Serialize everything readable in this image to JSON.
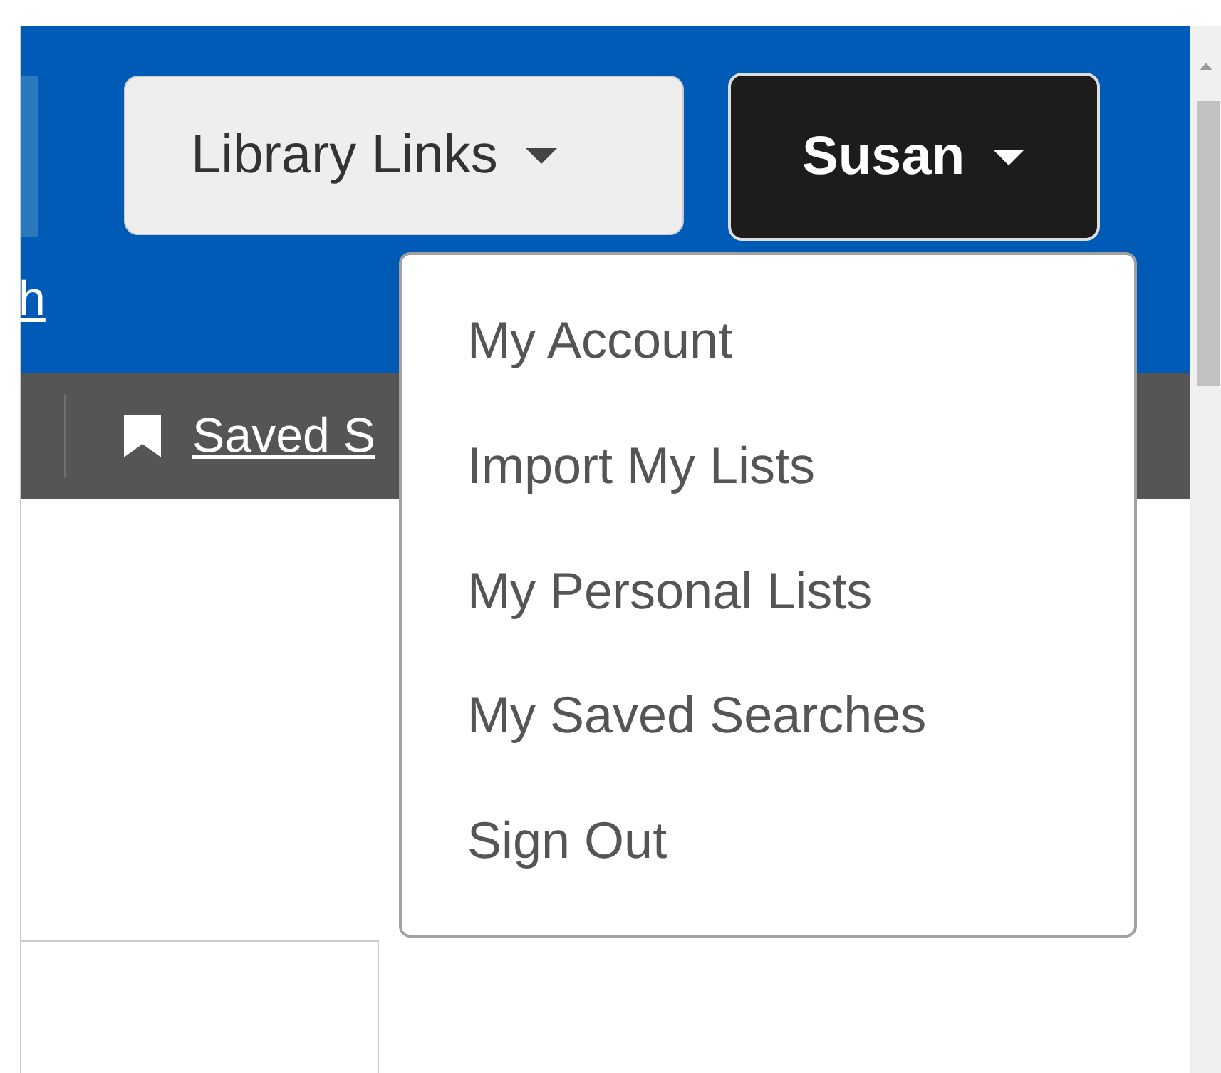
{
  "header": {
    "partial_link": "h",
    "buttons": [
      {
        "label": "Library Links",
        "kind": "light"
      },
      {
        "label": "Susan",
        "kind": "dark"
      }
    ]
  },
  "toolbar": {
    "link": "Saved S"
  },
  "user_menu": {
    "items": [
      "My Account",
      "Import My Lists",
      "My Personal Lists",
      "My Saved Searches",
      "Sign Out"
    ]
  }
}
